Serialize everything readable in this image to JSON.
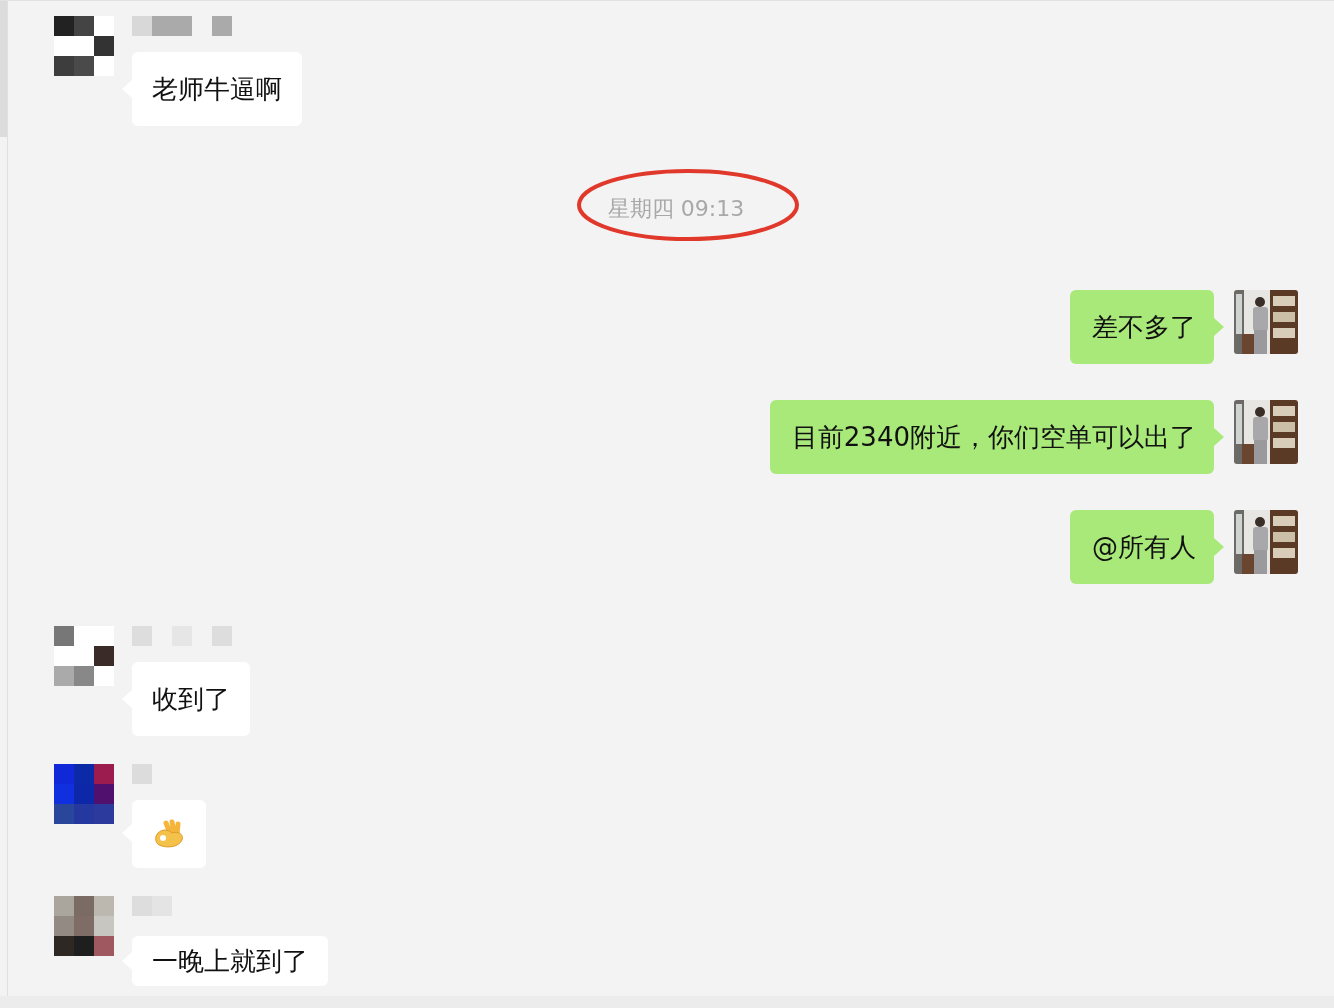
{
  "messages": [
    {
      "kind": "incoming",
      "text": "老师牛逼啊"
    },
    {
      "kind": "time",
      "text": "星期四 09:13",
      "circled": true
    },
    {
      "kind": "outgoing",
      "text": "差不多了"
    },
    {
      "kind": "outgoing",
      "text": "目前2340附近，你们空单可以出了"
    },
    {
      "kind": "outgoing",
      "text": "@所有人"
    },
    {
      "kind": "incoming",
      "text": "收到了"
    },
    {
      "kind": "incoming-emoji"
    },
    {
      "kind": "incoming",
      "text": "一晚上就到了"
    }
  ]
}
